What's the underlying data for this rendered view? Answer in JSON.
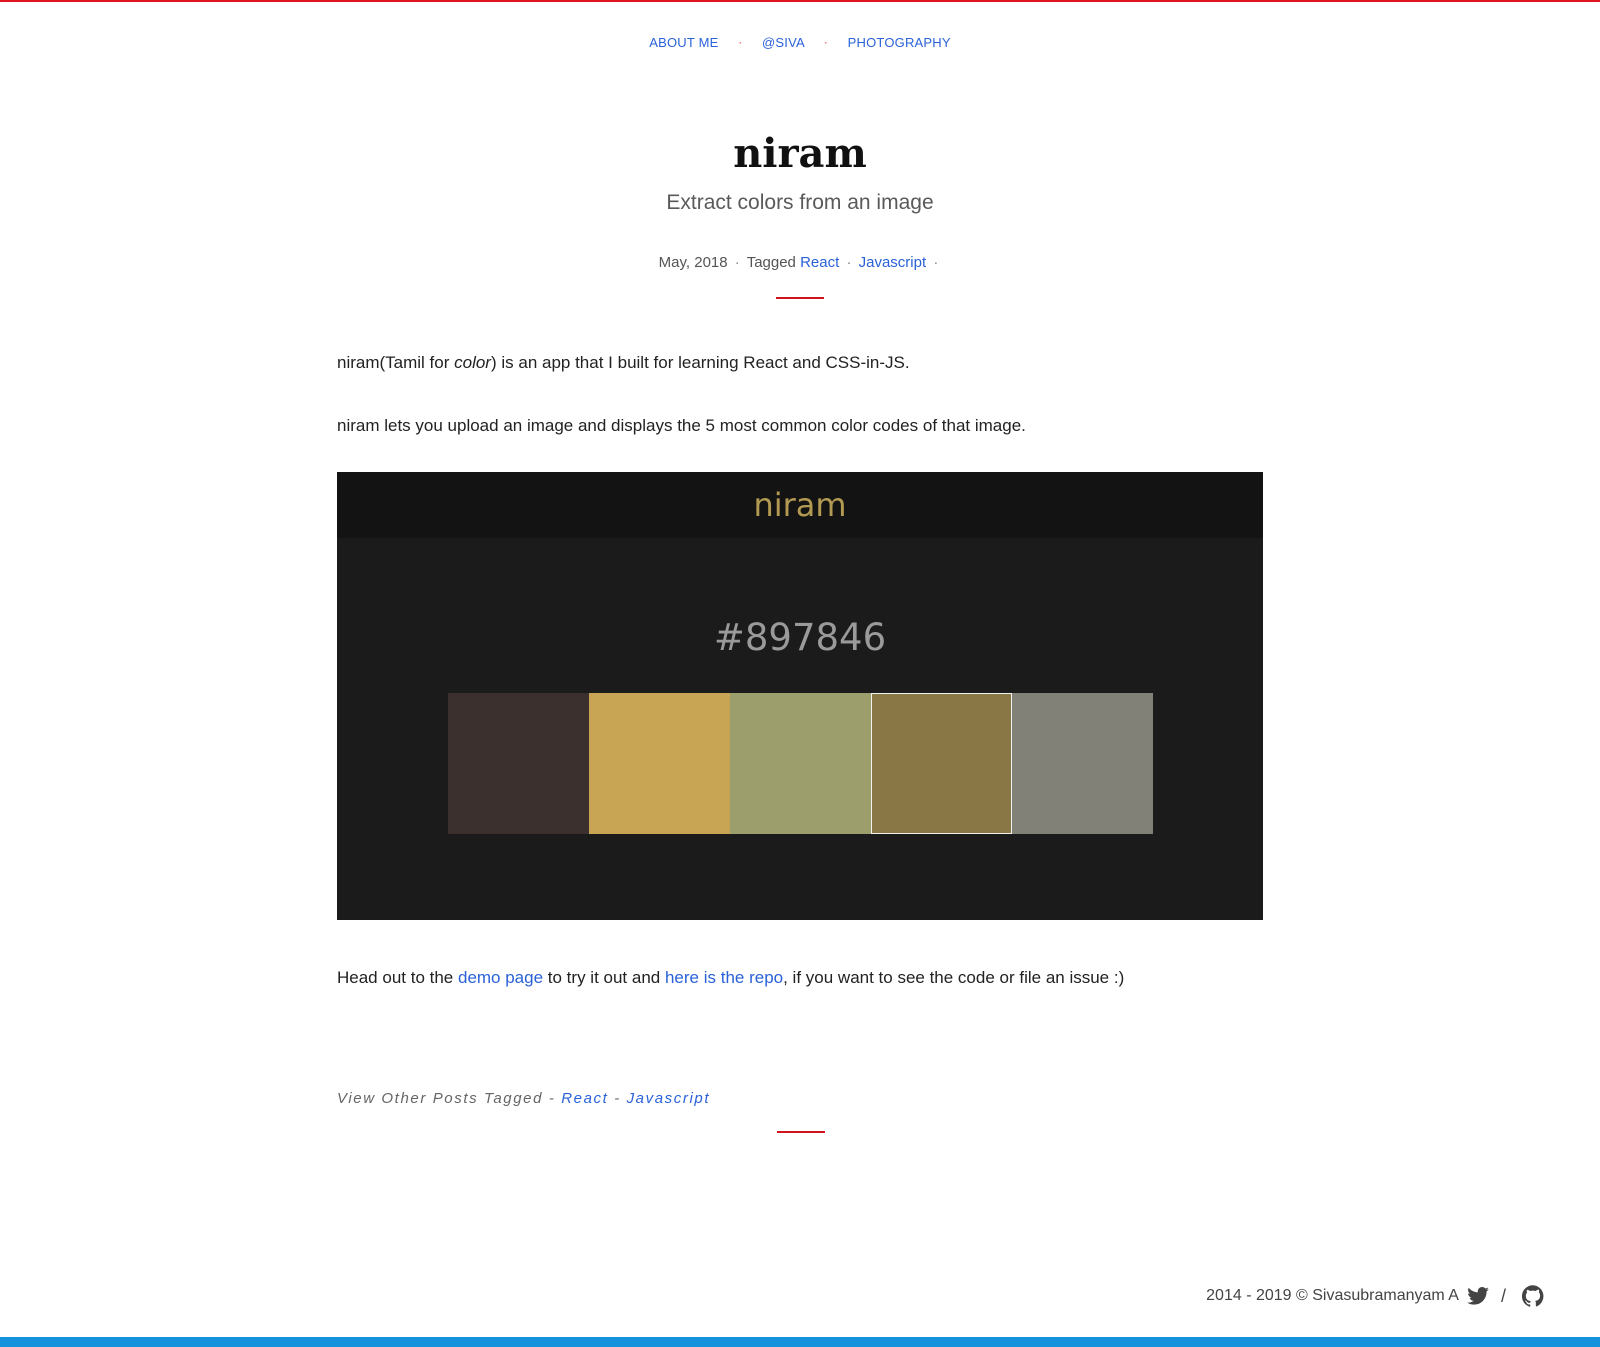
{
  "nav": {
    "items": [
      "ABOUT ME",
      "@SIVA",
      "PHOTOGRAPHY"
    ],
    "separator": "·"
  },
  "post": {
    "title": "niram",
    "subtitle": "Extract colors from an image",
    "date": "May, 2018",
    "tagged_label": "Tagged",
    "tags": [
      "React",
      "Javascript"
    ]
  },
  "body": {
    "p1_prefix": "niram(Tamil for ",
    "p1_em": "color",
    "p1_suffix": ") is an app that I built for learning React and CSS-in-JS.",
    "p2": "niram lets you upload an image and displays the 5 most common color codes of that image.",
    "p3_prefix": "Head out to the ",
    "p3_link1": "demo page",
    "p3_middle": " to try it out and ",
    "p3_link2": "here is the repo",
    "p3_suffix": ", if you want to see the code or file an issue :)"
  },
  "app_screenshot": {
    "title": "niram",
    "selected_hex": "#897846",
    "swatches": [
      "#3c302e",
      "#c8a455",
      "#9c9e6b",
      "#897846",
      "#828177"
    ],
    "selected_index": 3
  },
  "other_posts": {
    "label": "View Other Posts Tagged -",
    "sep": "-",
    "tags": [
      "React",
      "Javascript"
    ]
  },
  "footer": {
    "copyright": "2014 - 2019 © Sivasubramanyam A",
    "slash": "/"
  },
  "colors": {
    "accent_red": "#e0141e",
    "link_blue": "#2a62d8",
    "bottom_bar": "#1493dc"
  }
}
